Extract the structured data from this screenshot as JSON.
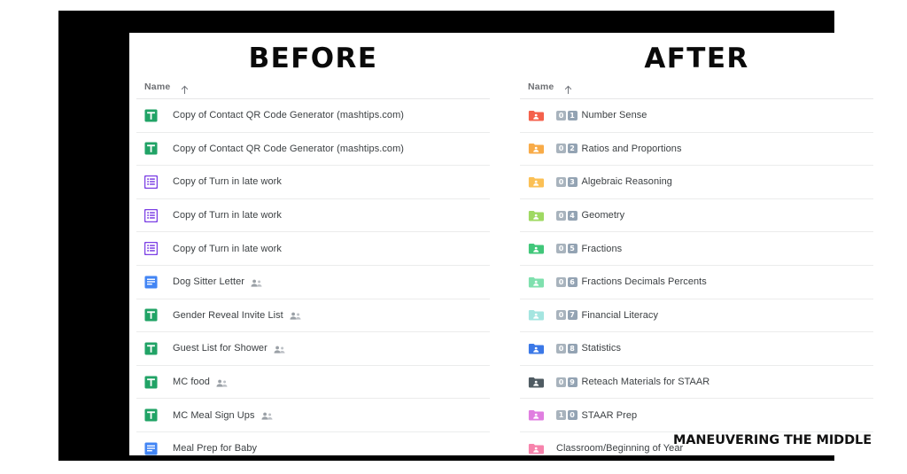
{
  "frame": {
    "watermark": "MANEUVERING THE MIDDLE"
  },
  "before": {
    "title": "BEFORE",
    "header": {
      "name_label": "Name",
      "sort_icon": "sort-ascending-arrow-icon"
    },
    "rows": [
      {
        "icon": "google-sheets-icon",
        "name": "Copy of Contact QR Code Generator (mashtips.com)",
        "shared": false
      },
      {
        "icon": "google-sheets-icon",
        "name": "Copy of Contact QR Code Generator (mashtips.com)",
        "shared": false
      },
      {
        "icon": "google-forms-icon",
        "name": "Copy of Turn in late work",
        "shared": false
      },
      {
        "icon": "google-forms-icon",
        "name": "Copy of Turn in late work",
        "shared": false
      },
      {
        "icon": "google-forms-icon",
        "name": "Copy of Turn in late work",
        "shared": false
      },
      {
        "icon": "google-docs-icon",
        "name": "Dog Sitter Letter",
        "shared": true
      },
      {
        "icon": "google-sheets-icon",
        "name": "Gender Reveal Invite List",
        "shared": true
      },
      {
        "icon": "google-sheets-icon",
        "name": "Guest List for Shower",
        "shared": true
      },
      {
        "icon": "google-sheets-icon",
        "name": "MC food",
        "shared": true
      },
      {
        "icon": "google-sheets-icon",
        "name": "MC Meal Sign Ups",
        "shared": true
      },
      {
        "icon": "google-docs-icon",
        "name": "Meal Prep for Baby",
        "shared": false
      }
    ]
  },
  "after": {
    "title": "AFTER",
    "header": {
      "name_label": "Name",
      "sort_icon": "sort-ascending-arrow-icon"
    },
    "rows": [
      {
        "icon": "shared-folder-icon",
        "color": "#f4614c",
        "badges": [
          "0",
          "1"
        ],
        "name": "Number Sense"
      },
      {
        "icon": "shared-folder-icon",
        "color": "#f8ab48",
        "badges": [
          "0",
          "2"
        ],
        "name": "Ratios and Proportions"
      },
      {
        "icon": "shared-folder-icon",
        "color": "#fbc055",
        "badges": [
          "0",
          "3"
        ],
        "name": "Algebraic Reasoning"
      },
      {
        "icon": "shared-folder-icon",
        "color": "#9fd962",
        "badges": [
          "0",
          "4"
        ],
        "name": "Geometry"
      },
      {
        "icon": "shared-folder-icon",
        "color": "#41c77a",
        "badges": [
          "0",
          "5"
        ],
        "name": "Fractions"
      },
      {
        "icon": "shared-folder-icon",
        "color": "#7fe0ae",
        "badges": [
          "0",
          "6"
        ],
        "name": "Fractions Decimals Percents"
      },
      {
        "icon": "shared-folder-icon",
        "color": "#a4e5e0",
        "badges": [
          "0",
          "7"
        ],
        "name": "Financial Literacy"
      },
      {
        "icon": "shared-folder-icon",
        "color": "#3b78e7",
        "badges": [
          "0",
          "8"
        ],
        "name": "Statistics"
      },
      {
        "icon": "shared-folder-icon",
        "color": "#4f5b62",
        "badges": [
          "0",
          "9"
        ],
        "name": "Reteach Materials for STAAR"
      },
      {
        "icon": "shared-folder-icon",
        "color": "#e07ee0",
        "badges": [
          "1",
          "0"
        ],
        "name": "STAAR Prep"
      },
      {
        "icon": "shared-folder-icon",
        "color": "#f783ac",
        "badges": [],
        "name": "Classroom/Beginning of Year"
      }
    ]
  },
  "colors": {
    "sheets_green": "#21a366",
    "forms_purple": "#7b3fe4",
    "docs_blue": "#4285f4",
    "frame_black": "#000000",
    "row_divider": "#ebecec",
    "text_primary": "#3c4043",
    "text_muted": "#6d6f73"
  }
}
